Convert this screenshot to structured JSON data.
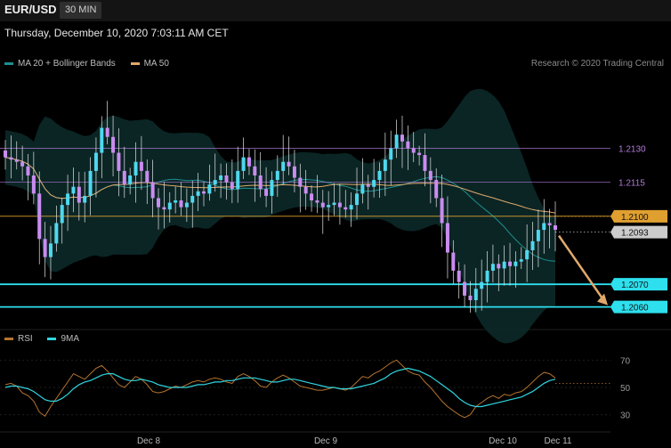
{
  "header": {
    "symbol": "EUR/USD",
    "timeframe": "30 MIN",
    "timestamp": "Thursday, December 10, 2020 7:03:11 AM CET"
  },
  "legend_main": [
    {
      "label": "MA 20 + Bollinger Bands",
      "color": "#1e8f8f"
    },
    {
      "label": "MA 50",
      "color": "#e0a96b"
    }
  ],
  "copyright": "Research © 2020 Trading Central",
  "legend_rsi": [
    {
      "label": "RSI",
      "color": "#b5742e"
    },
    {
      "label": "9MA",
      "color": "#2fd6e0"
    }
  ],
  "chart_data": [
    {
      "type": "candlestick",
      "title": "",
      "x_tick_labels": [
        "Dec 8",
        "Dec 9",
        "Dec 10",
        "Dec 11"
      ],
      "ylim": [
        1.2052,
        1.2162
      ],
      "levels": [
        {
          "value": 1.213,
          "label": "1.2130",
          "color": "#b07ad8",
          "style": "line"
        },
        {
          "value": 1.2115,
          "label": "1.2115",
          "color": "#b07ad8",
          "style": "line"
        },
        {
          "value": 1.21,
          "label": "1.2100",
          "color": "#e0a030",
          "style": "badge"
        },
        {
          "value": 1.2093,
          "label": "1.2093",
          "color": "#cccccc",
          "style": "badge"
        },
        {
          "value": 1.207,
          "label": "1.2070",
          "color": "#2ee0ee",
          "style": "badge"
        },
        {
          "value": 1.206,
          "label": "1.2060",
          "color": "#2ee0ee",
          "style": "badge"
        }
      ],
      "forecast_arrow": {
        "from": 1.2093,
        "to": 1.206
      },
      "close": [
        1.2126,
        1.2125,
        1.2124,
        1.2122,
        1.2118,
        1.211,
        1.209,
        1.2082,
        1.2088,
        1.2097,
        1.2105,
        1.211,
        1.2113,
        1.2106,
        1.2109,
        1.212,
        1.2128,
        1.2139,
        1.2135,
        1.2128,
        1.212,
        1.2114,
        1.2118,
        1.2124,
        1.212,
        1.2115,
        1.2108,
        1.2104,
        1.2103,
        1.2106,
        1.2107,
        1.2104,
        1.2106,
        1.2109,
        1.2111,
        1.211,
        1.2114,
        1.2116,
        1.2118,
        1.2115,
        1.2112,
        1.212,
        1.2126,
        1.2122,
        1.2118,
        1.2112,
        1.2109,
        1.2116,
        1.212,
        1.2124,
        1.2122,
        1.2117,
        1.2113,
        1.211,
        1.2107,
        1.2106,
        1.2104,
        1.2105,
        1.2106,
        1.2104,
        1.2103,
        1.2105,
        1.211,
        1.2114,
        1.2113,
        1.2116,
        1.212,
        1.2125,
        1.213,
        1.2136,
        1.2133,
        1.213,
        1.2128,
        1.2127,
        1.212,
        1.2116,
        1.2108,
        1.2097,
        1.2084,
        1.2076,
        1.2071,
        1.2065,
        1.2063,
        1.2068,
        1.2071,
        1.2076,
        1.2079,
        1.2077,
        1.208,
        1.2078,
        1.208,
        1.2081,
        1.2085,
        1.2089,
        1.2094,
        1.2097,
        1.2096,
        1.2094
      ]
    },
    {
      "type": "line",
      "title": "",
      "y_tick_labels": [
        "70",
        "50",
        "30"
      ],
      "ylim": [
        22,
        78
      ],
      "series": [
        {
          "name": "RSI",
          "values": [
            52,
            53,
            51,
            46,
            44,
            40,
            32,
            29,
            36,
            42,
            48,
            54,
            60,
            58,
            56,
            60,
            64,
            66,
            62,
            57,
            52,
            50,
            54,
            58,
            56,
            52,
            47,
            46,
            47,
            49,
            51,
            50,
            52,
            54,
            55,
            54,
            56,
            57,
            56,
            54,
            53,
            58,
            60,
            58,
            55,
            51,
            50,
            54,
            57,
            59,
            57,
            54,
            51,
            50,
            49,
            48,
            48,
            49,
            50,
            49,
            48,
            50,
            54,
            58,
            57,
            60,
            62,
            65,
            68,
            70,
            66,
            62,
            60,
            59,
            54,
            50,
            45,
            40,
            36,
            33,
            30,
            28,
            30,
            36,
            39,
            42,
            44,
            42,
            45,
            44,
            46,
            47,
            50,
            54,
            58,
            61,
            60,
            57
          ]
        },
        {
          "name": "9MA",
          "values": [
            50,
            51,
            51,
            50,
            49,
            47,
            44,
            41,
            40,
            40,
            42,
            45,
            49,
            52,
            54,
            55,
            57,
            59,
            60,
            60,
            58,
            56,
            55,
            55,
            56,
            55,
            54,
            52,
            51,
            50,
            50,
            50,
            50,
            51,
            52,
            52,
            53,
            54,
            54,
            55,
            55,
            56,
            57,
            57,
            57,
            56,
            55,
            54,
            54,
            55,
            56,
            56,
            55,
            54,
            53,
            52,
            51,
            50,
            50,
            49,
            49,
            49,
            50,
            51,
            52,
            53,
            55,
            57,
            60,
            62,
            63,
            64,
            63,
            62,
            60,
            58,
            55,
            52,
            49,
            46,
            42,
            39,
            37,
            36,
            36,
            37,
            38,
            39,
            40,
            41,
            42,
            43,
            45,
            47,
            50,
            53,
            55,
            56
          ]
        }
      ],
      "levels": [
        70,
        50,
        30
      ]
    }
  ]
}
